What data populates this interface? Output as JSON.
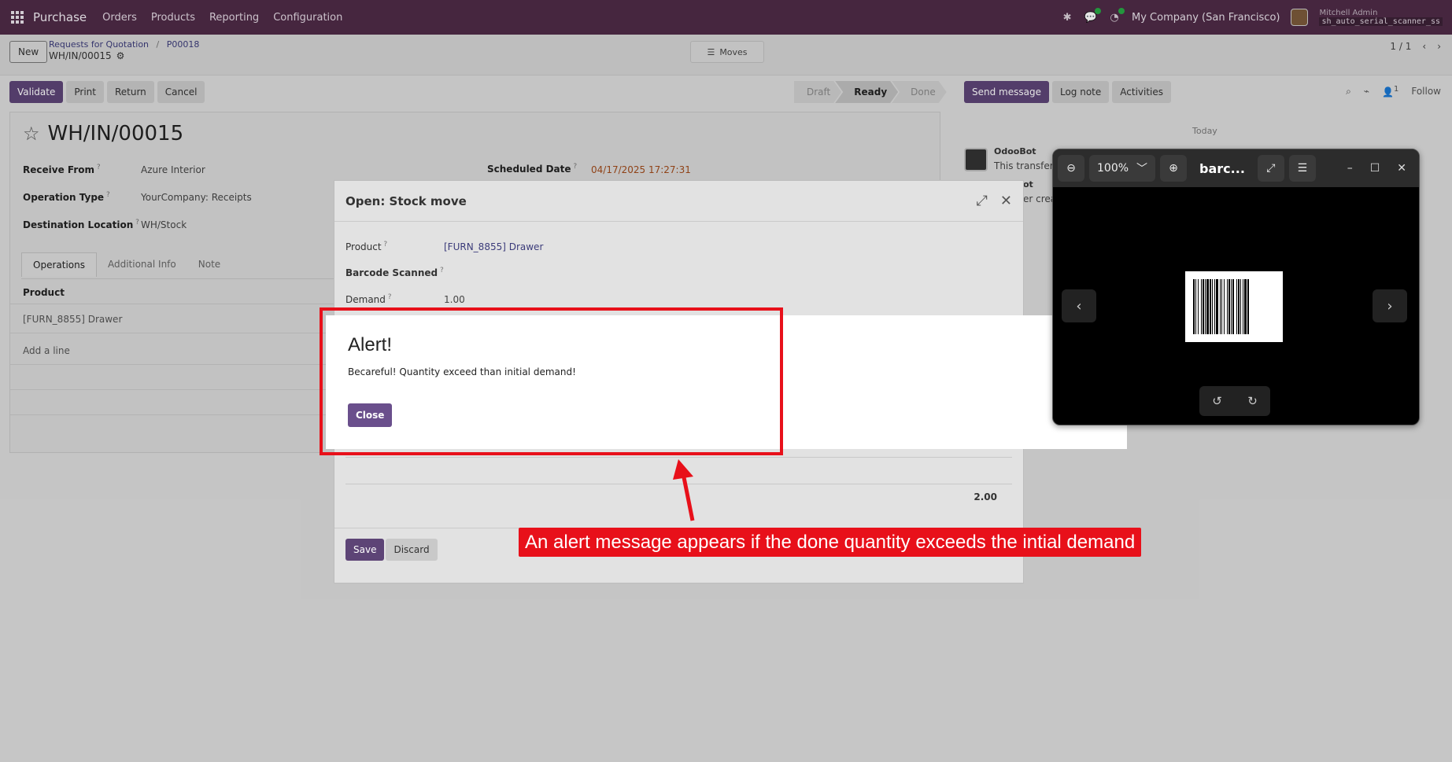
{
  "navbar": {
    "app_name": "Purchase",
    "menu": [
      "Orders",
      "Products",
      "Reporting",
      "Configuration"
    ],
    "company": "My Company (San Francisco)",
    "user": "Mitchell Admin",
    "database": "sh_auto_serial_scanner_ss"
  },
  "controlpanel": {
    "new_label": "New",
    "breadcrumb": [
      "Requests for Quotation",
      "P00018"
    ],
    "current_record": "WH/IN/00015",
    "moves_label": "Moves",
    "pager": "1 / 1"
  },
  "actions": {
    "validate": "Validate",
    "print": "Print",
    "return": "Return",
    "cancel": "Cancel"
  },
  "status": {
    "steps": [
      "Draft",
      "Ready",
      "Done"
    ],
    "active": "Ready"
  },
  "form": {
    "title": "WH/IN/00015",
    "receive_from_label": "Receive From",
    "receive_from": "Azure Interior",
    "operation_type_label": "Operation Type",
    "operation_type": "YourCompany: Receipts",
    "destination_label": "Destination Location",
    "destination": "WH/Stock",
    "scheduled_label": "Scheduled Date",
    "scheduled_date": "04/17/2025 17:27:31",
    "tabs": [
      "Operations",
      "Additional Info",
      "Note"
    ],
    "lines_header": "Product",
    "line_product": "[FURN_8855] Drawer",
    "add_line": "Add a line"
  },
  "chatter": {
    "send_message": "Send message",
    "log_note": "Log note",
    "activities": "Activities",
    "follow": "Follow",
    "followers_count": "1",
    "today": "Today",
    "author": "OdooBot",
    "message": "This transfer",
    "author2": "ot",
    "message2": "er crea"
  },
  "modal": {
    "title": "Open: Stock move",
    "product_label": "Product",
    "product": "[FURN_8855] Drawer",
    "barcode_label": "Barcode Scanned",
    "demand_label": "Demand",
    "demand": "1.00",
    "total": "2.00",
    "save": "Save",
    "discard": "Discard"
  },
  "alert": {
    "title": "Alert!",
    "message": "Becareful! Quantity exceed than initial demand!",
    "close": "Close"
  },
  "viewer": {
    "zoom": "100%",
    "title": "barc..."
  },
  "annotation": {
    "caption": "An alert message appears if the done quantity exceeds the intial demand"
  },
  "colors": {
    "navbar": "#4e2b47",
    "primary": "#5d4476",
    "annotation": "#e8101a"
  }
}
